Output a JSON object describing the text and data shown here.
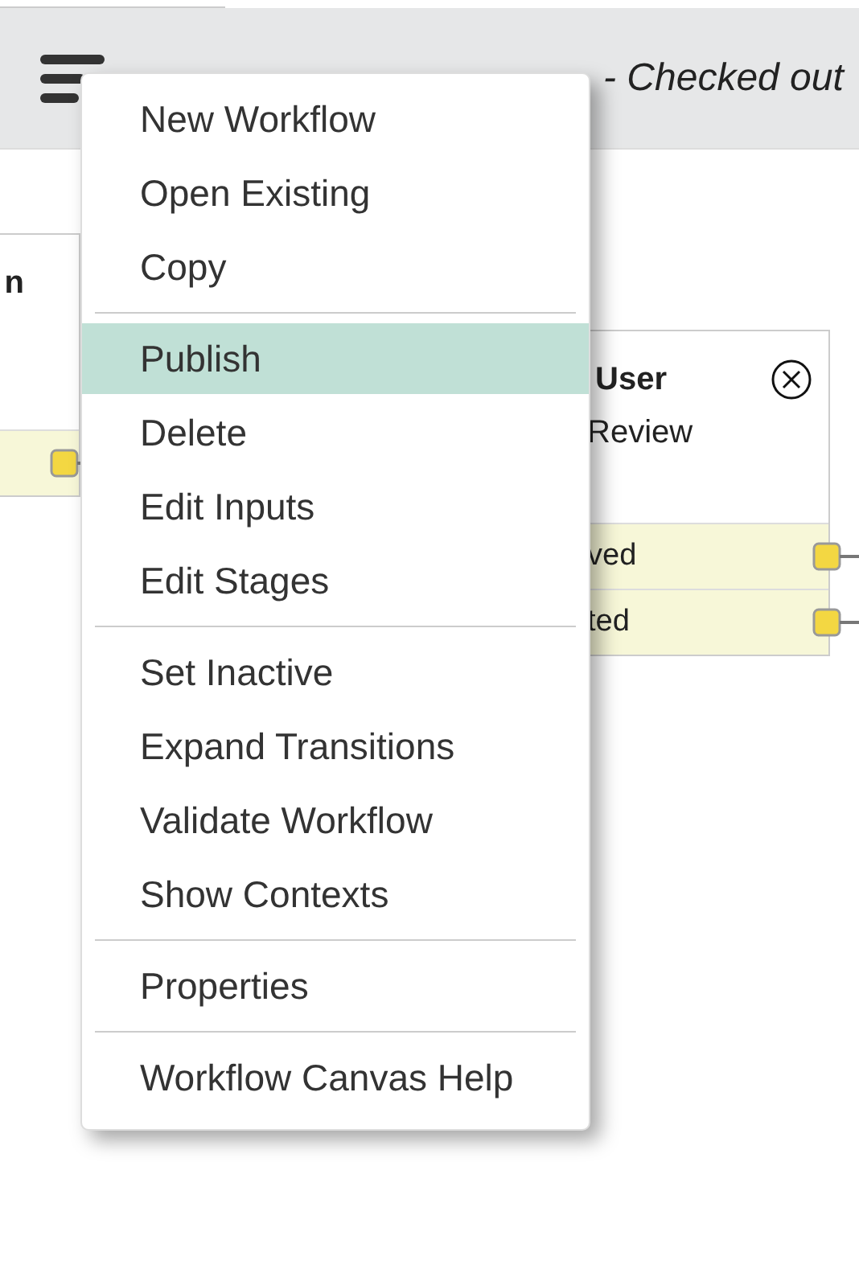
{
  "header": {
    "status": "- Checked out"
  },
  "canvas": {
    "nodes": [
      {
        "title": "n",
        "rows": [
          {
            "kind": "transition"
          }
        ],
        "closable": false
      },
      {
        "title": "User",
        "subtitle": "Review",
        "rows": [
          {
            "kind": "transition",
            "label": "ved"
          },
          {
            "kind": "transition",
            "label": "ted"
          }
        ],
        "closable": true
      }
    ]
  },
  "menu": {
    "groups": [
      [
        {
          "label": "New Workflow",
          "selected": false
        },
        {
          "label": "Open Existing",
          "selected": false
        },
        {
          "label": "Copy",
          "selected": false
        }
      ],
      [
        {
          "label": "Publish",
          "selected": true
        },
        {
          "label": "Delete",
          "selected": false
        },
        {
          "label": "Edit Inputs",
          "selected": false
        },
        {
          "label": "Edit Stages",
          "selected": false
        }
      ],
      [
        {
          "label": "Set Inactive",
          "selected": false
        },
        {
          "label": "Expand Transitions",
          "selected": false
        },
        {
          "label": "Validate Workflow",
          "selected": false
        },
        {
          "label": "Show Contexts",
          "selected": false
        }
      ],
      [
        {
          "label": "Properties",
          "selected": false
        }
      ],
      [
        {
          "label": "Workflow Canvas Help",
          "selected": false
        }
      ]
    ]
  }
}
